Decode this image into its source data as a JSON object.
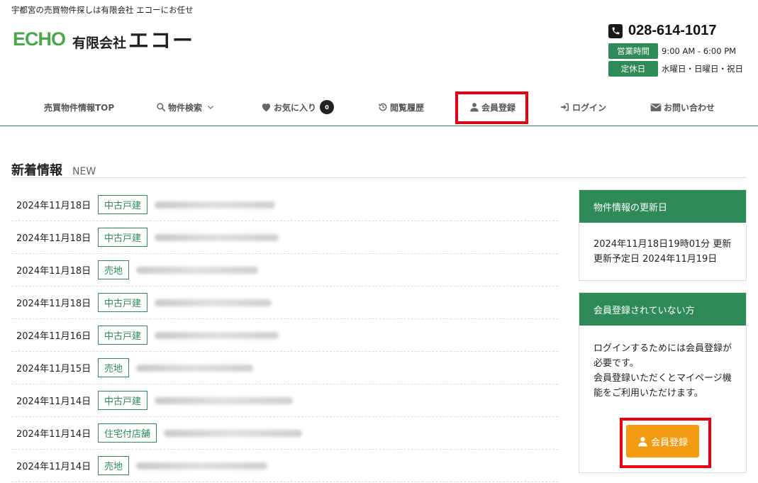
{
  "header": {
    "tagline": "宇都宮の売買物件探しは有限会社 エコーにお任せ",
    "logo_mark": "ECHO",
    "company_prefix": "有限会社",
    "company_name": "エコー",
    "phone": "028-614-1017",
    "hours": [
      {
        "label": "営業時間",
        "value": "9:00 AM - 6:00 PM"
      },
      {
        "label": "定休日",
        "value": "水曜日・日曜日・祝日"
      }
    ]
  },
  "nav": {
    "items": [
      {
        "label": "売買物件情報TOP",
        "icon": "none"
      },
      {
        "label": "物件検索",
        "icon": "search-icon"
      },
      {
        "label": "お気に入り",
        "icon": "heart-icon"
      },
      {
        "label": "閲覧履歴",
        "icon": "history-icon"
      },
      {
        "label": "会員登録",
        "icon": "user-icon"
      },
      {
        "label": "ログイン",
        "icon": "login-icon"
      },
      {
        "label": "お問い合わせ",
        "icon": "mail-icon"
      }
    ],
    "favorites_count": "0"
  },
  "news": {
    "title": "新着情報",
    "title_en": "NEW",
    "items": [
      {
        "date": "2024年11月18日",
        "category": "中古戸建"
      },
      {
        "date": "2024年11月18日",
        "category": "中古戸建"
      },
      {
        "date": "2024年11月18日",
        "category": "売地"
      },
      {
        "date": "2024年11月18日",
        "category": "中古戸建"
      },
      {
        "date": "2024年11月16日",
        "category": "中古戸建"
      },
      {
        "date": "2024年11月15日",
        "category": "売地"
      },
      {
        "date": "2024年11月14日",
        "category": "中古戸建"
      },
      {
        "date": "2024年11月14日",
        "category": "住宅付店舗"
      },
      {
        "date": "2024年11月14日",
        "category": "売地"
      }
    ]
  },
  "sidebar": {
    "update_card": {
      "title": "物件情報の更新日",
      "line1": "2024年11月18日19時01分 更新",
      "line2": "更新予定日 2024年11月19日"
    },
    "member_card": {
      "title": "会員登録されていない方",
      "text1": "ログインするためには会員登録が必要です。",
      "text2": "会員登録いただくとマイページ機能をご利用いただけます。",
      "button_label": "会員登録"
    }
  },
  "colors": {
    "brand_green": "#2e8b57",
    "logo_green": "#4aa84a",
    "button_orange": "#f39c12",
    "highlight_red": "#e60012"
  }
}
